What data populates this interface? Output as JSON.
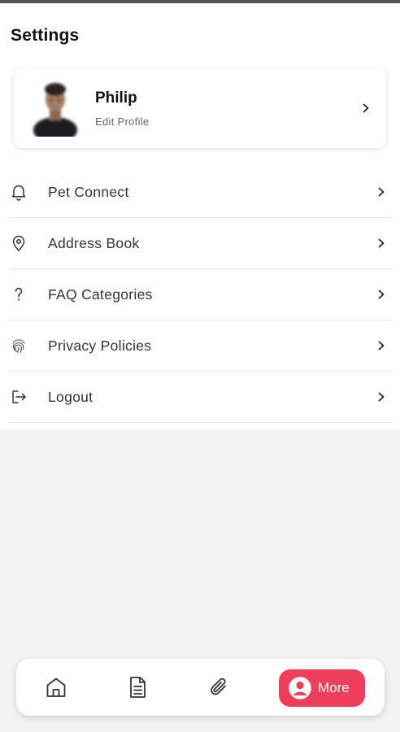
{
  "header": {
    "title": "Settings"
  },
  "profile": {
    "name": "Philip",
    "subtitle": "Edit Profile"
  },
  "menu": {
    "items": [
      {
        "label": "Pet Connect",
        "icon": "bell-icon"
      },
      {
        "label": "Address Book",
        "icon": "location-pin-icon"
      },
      {
        "label": "FAQ Categories",
        "icon": "question-icon"
      },
      {
        "label": "Privacy Policies",
        "icon": "fingerprint-icon"
      },
      {
        "label": "Logout",
        "icon": "logout-icon"
      }
    ]
  },
  "bottom_nav": {
    "items": [
      {
        "icon": "home-icon"
      },
      {
        "icon": "document-icon"
      },
      {
        "icon": "paperclip-icon"
      },
      {
        "icon": "user-circle-icon",
        "label": "More",
        "active": true
      }
    ],
    "accent_color": "#ee3e5b"
  }
}
